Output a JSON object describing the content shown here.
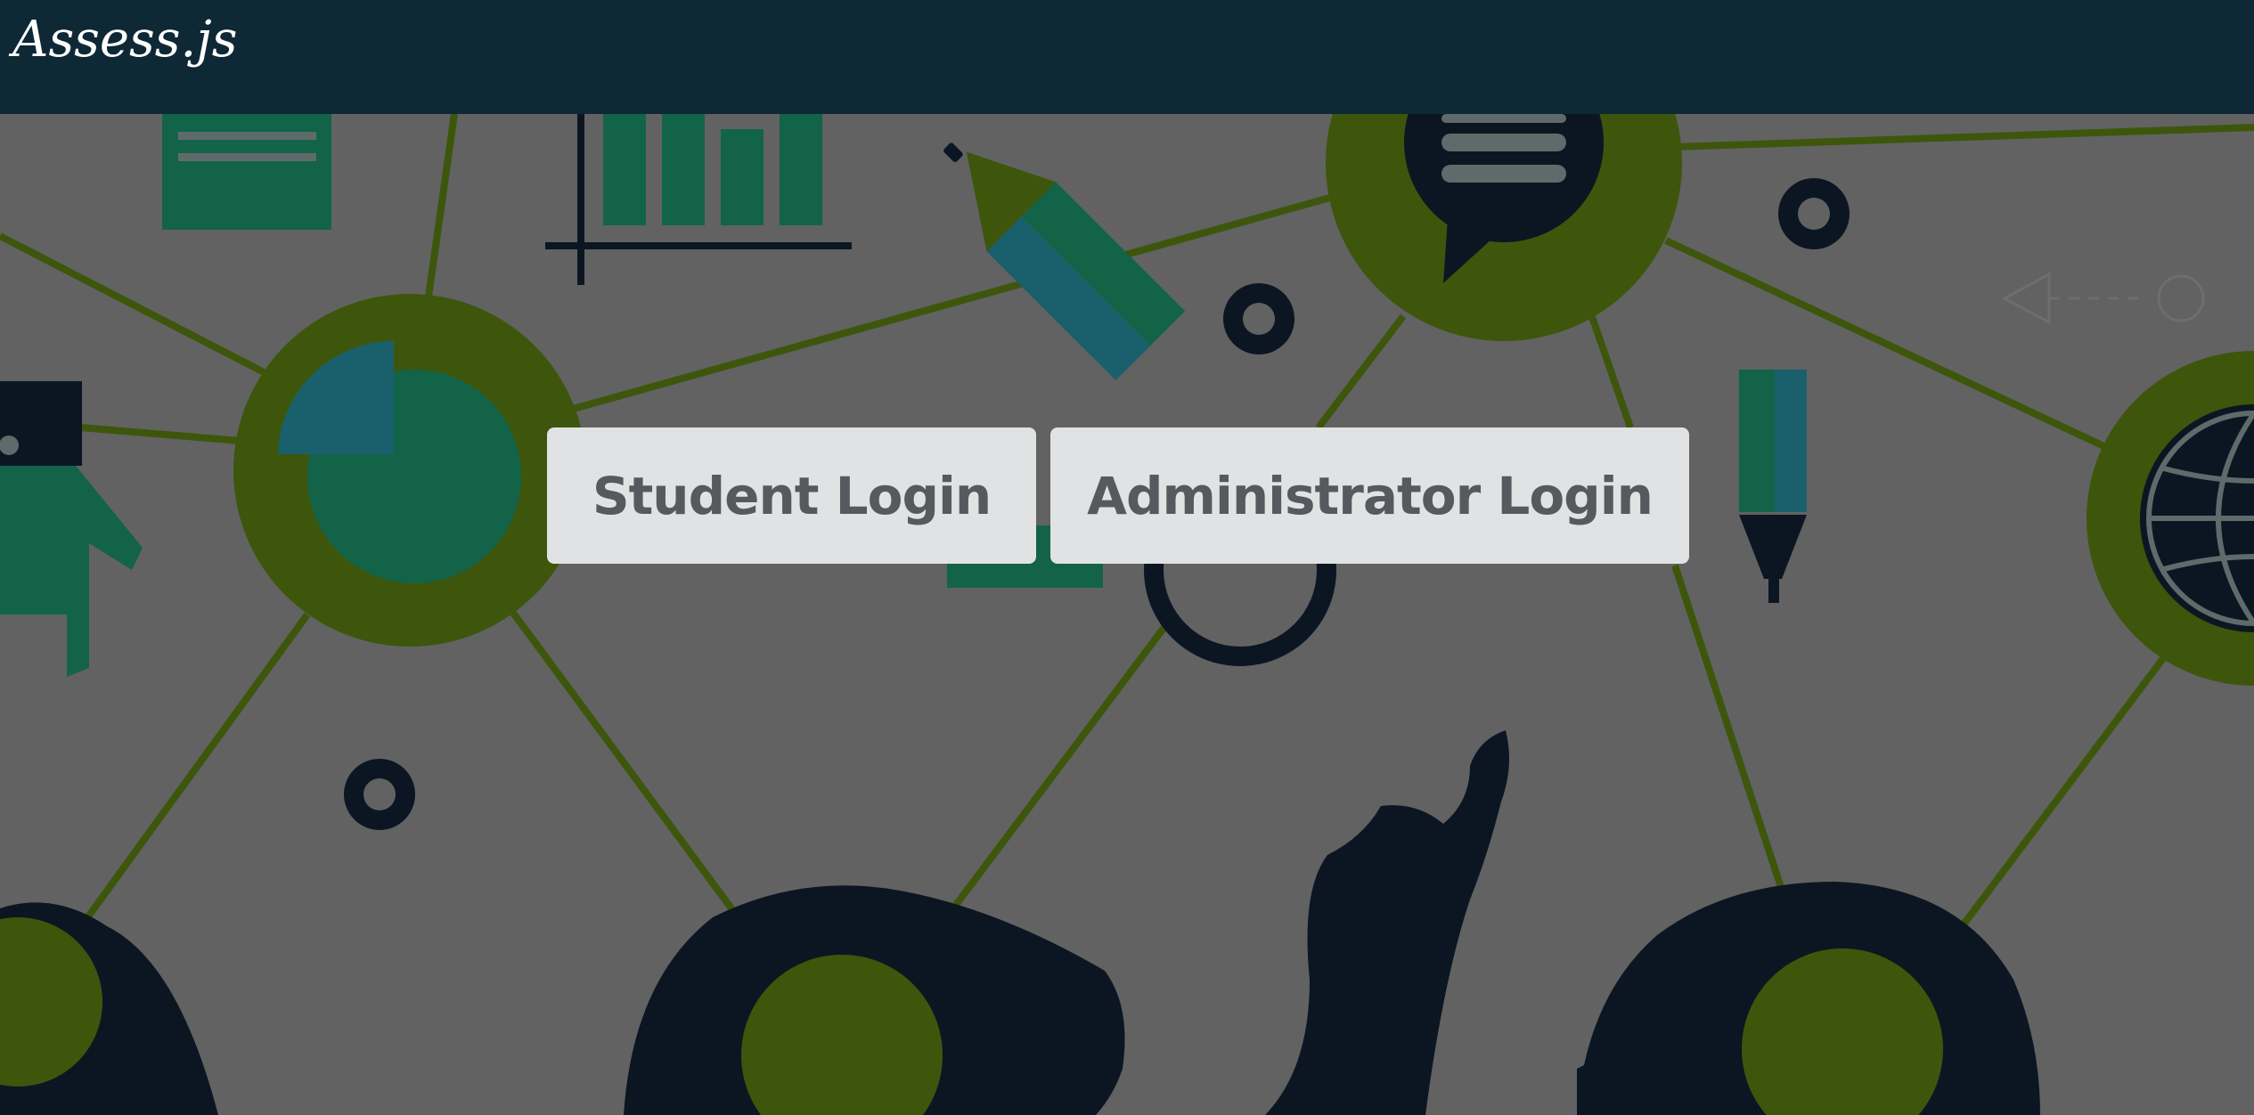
{
  "navbar": {
    "brand": "Assess.js"
  },
  "login": {
    "student_label": "Student Login",
    "admin_label": "Administrator Login"
  },
  "background": {
    "icons": [
      "document-icon",
      "bar-chart-icon",
      "pencil-icon",
      "gear-icon",
      "speech-bubble-icon",
      "pie-chart-icon",
      "hand-icon",
      "marker-icon",
      "globe-icon",
      "magnifier-icon",
      "people-silhouette"
    ]
  },
  "colors": {
    "navbar": "#0e2835",
    "background": "#626262",
    "button": "#e1e2e3",
    "button_text": "#565a5e",
    "olive": "#3d560c",
    "teal": "#136349",
    "blue_teal": "#1a5f6c",
    "dark": "#0c1622"
  }
}
